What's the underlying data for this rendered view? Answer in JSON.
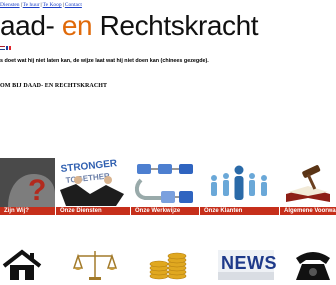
{
  "nav": {
    "links": [
      "Diensten",
      "Te huur",
      "Te Koop",
      "Contact"
    ],
    "separator": "|"
  },
  "brand": {
    "word1": "aad-",
    "word2": "en",
    "word3": "Rechtskracht"
  },
  "quote": "s doet wat hij niet laten kan, de wijze laat wat hij niet doen kan (chinees gezegde).",
  "welcome": "OM BIJ DAAD- EN RECHTSKRACHT",
  "tiles": [
    {
      "caption": "Zijn Wij?"
    },
    {
      "caption": "Onze Diensten",
      "art_text": "STRONGER TOGETHER"
    },
    {
      "caption": "Onze Werkwijze"
    },
    {
      "caption": "Onze Klanten"
    },
    {
      "caption": "Algemene Voorwaarden"
    }
  ],
  "bottom_icons": [
    {
      "icon": "house-icon"
    },
    {
      "icon": "scales-icon"
    },
    {
      "icon": "coins-icon"
    },
    {
      "icon": "news-icon",
      "text": "NEWS"
    },
    {
      "icon": "telephone-icon"
    }
  ],
  "colors": {
    "accent": "#e06a0a",
    "caption_bg": "#c62f1b",
    "link": "#1a3ec7"
  }
}
